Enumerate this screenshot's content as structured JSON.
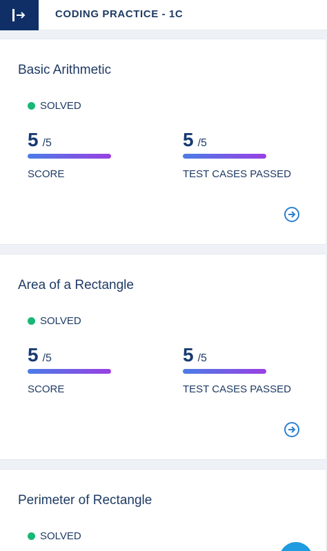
{
  "header": {
    "title": "CODING PRACTICE - 1C",
    "menu_icon": "sidebar-expand-icon"
  },
  "colors": {
    "brand": "#0f2f66",
    "text": "#1e3a64",
    "solved": "#18b877",
    "bar_start": "#4a7de6",
    "bar_end": "#9a3fe3",
    "link": "#2e7fd0"
  },
  "cards": [
    {
      "title": "Basic Arithmetic",
      "status": "SOLVED",
      "score": {
        "value": "5",
        "total": "/5",
        "label": "SCORE",
        "progress": 1.0
      },
      "tests": {
        "value": "5",
        "total": "/5",
        "label": "TEST CASES PASSED",
        "progress": 1.0
      },
      "action_icon": "arrow-right-circle-icon"
    },
    {
      "title": "Area of a Rectangle",
      "status": "SOLVED",
      "score": {
        "value": "5",
        "total": "/5",
        "label": "SCORE",
        "progress": 1.0
      },
      "tests": {
        "value": "5",
        "total": "/5",
        "label": "TEST CASES PASSED",
        "progress": 1.0
      },
      "action_icon": "arrow-right-circle-icon"
    },
    {
      "title": "Perimeter of Rectangle",
      "status": "SOLVED"
    }
  ]
}
